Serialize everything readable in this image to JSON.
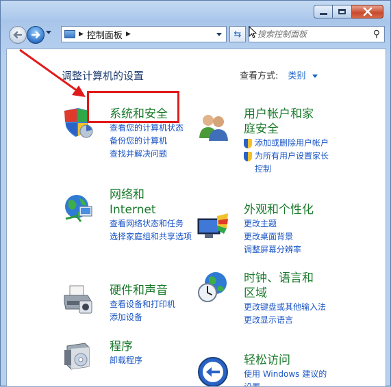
{
  "address": {
    "items": [
      "控制面板"
    ]
  },
  "search": {
    "placeholder": "搜索控制面板"
  },
  "page": {
    "title": "调整计算机的设置",
    "view_by_label": "查看方式:",
    "view_by_value": "类别"
  },
  "categories": {
    "security": {
      "title": "系统和安全",
      "links": [
        "查看您的计算机状态",
        "备份您的计算机",
        "查找并解决问题"
      ]
    },
    "network": {
      "title_line1": "网络和",
      "title_line2": "Internet",
      "links": [
        "查看网络状态和任务",
        "选择家庭组和共享选项"
      ]
    },
    "hardware": {
      "title": "硬件和声音",
      "links": [
        "查看设备和打印机",
        "添加设备"
      ]
    },
    "programs": {
      "title": "程序",
      "links": [
        "卸载程序"
      ]
    },
    "users": {
      "title_line1": "用户帐户和家",
      "title_line2": "庭安全",
      "links": [
        "添加或删除用户帐户",
        "为所有用户设置家长控制"
      ]
    },
    "appearance": {
      "title": "外观和个性化",
      "links": [
        "更改主题",
        "更改桌面背景",
        "调整屏幕分辨率"
      ]
    },
    "clock": {
      "title_line1": "时钟、语言和",
      "title_line2": "区域",
      "links": [
        "更改键盘或其他输入法",
        "更改显示语言"
      ]
    },
    "ease": {
      "title": "轻松访问",
      "links": [
        "使用 Windows 建议的设置"
      ]
    }
  },
  "colors": {
    "highlight": "#e11b1b",
    "link": "#1a55c5",
    "category": "#1a7a2b"
  }
}
